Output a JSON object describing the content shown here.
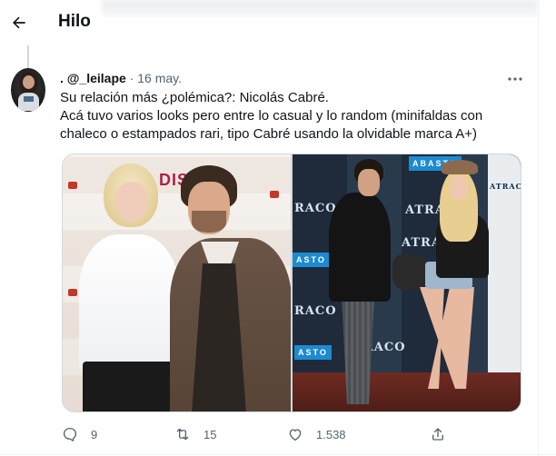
{
  "header": {
    "title": "Hilo"
  },
  "tweet": {
    "display_name": ". @_leilape",
    "separator": " · ",
    "date": "16 may.",
    "more_icon": "more-dots-icon",
    "lines": [
      "Su relación más ¿polémica?: Nicolás Cabré.",
      "Acá tuvo varios looks pero entre lo casual y lo random (minifaldas con",
      "chaleco o estampados rari, tipo Cabré usando la olvidable marca A+)"
    ]
  },
  "media": {
    "left_photo": {
      "backdrop_text": "DIS"
    },
    "right_photo": {
      "backdrop_texts": [
        "RACO",
        "ATRAC",
        "ABASTO",
        "ASTO",
        "RACO",
        "ATRACO",
        "RACO",
        "ASTO",
        "ATRACO"
      ]
    }
  },
  "actions": {
    "reply_count": "9",
    "retweet_count": "15",
    "like_count": "1.538"
  },
  "colors": {
    "text_primary": "#0f1419",
    "text_secondary": "#536471",
    "border": "#cfd9de"
  }
}
